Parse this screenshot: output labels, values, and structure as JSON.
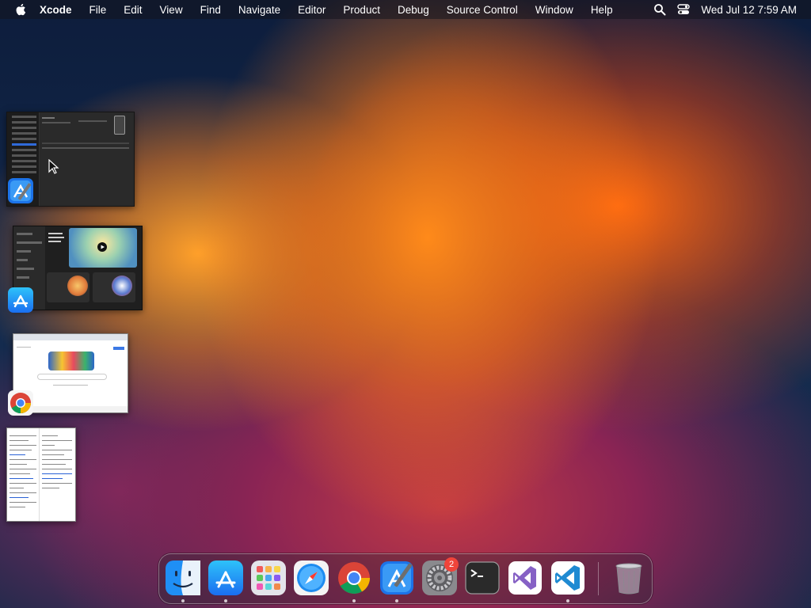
{
  "menubar": {
    "app_name": "Xcode",
    "menus": [
      "File",
      "Edit",
      "View",
      "Find",
      "Navigate",
      "Editor",
      "Product",
      "Debug",
      "Source Control",
      "Window",
      "Help"
    ],
    "clock": "Wed Jul 12  7:59 AM",
    "icons": [
      "apple-logo-icon",
      "spotlight-search-icon",
      "control-center-icon"
    ]
  },
  "window_thumbnails": [
    {
      "app": "Xcode",
      "icon": "xcode-icon"
    },
    {
      "app": "App Store",
      "icon": "app-store-icon"
    },
    {
      "app": "Google Chrome",
      "icon": "chrome-icon"
    },
    {
      "app": "Document",
      "icon": "document-icon"
    }
  ],
  "dock": {
    "items": [
      {
        "name": "Finder",
        "icon": "finder-icon",
        "running": true
      },
      {
        "name": "App Store",
        "icon": "app-store-icon",
        "running": true
      },
      {
        "name": "Launchpad",
        "icon": "launchpad-icon",
        "running": false
      },
      {
        "name": "Safari",
        "icon": "safari-icon",
        "running": false
      },
      {
        "name": "Google Chrome",
        "icon": "chrome-icon",
        "running": true
      },
      {
        "name": "Xcode",
        "icon": "xcode-icon",
        "running": true
      },
      {
        "name": "System Settings",
        "icon": "system-settings-icon",
        "running": false,
        "badge": "2"
      },
      {
        "name": "Terminal",
        "icon": "terminal-icon",
        "running": false
      },
      {
        "name": "Visual Studio",
        "icon": "visual-studio-icon",
        "running": false
      },
      {
        "name": "Visual Studio Code",
        "icon": "vscode-icon",
        "running": true
      },
      {
        "name": "Trash",
        "icon": "trash-icon",
        "running": false
      }
    ]
  }
}
